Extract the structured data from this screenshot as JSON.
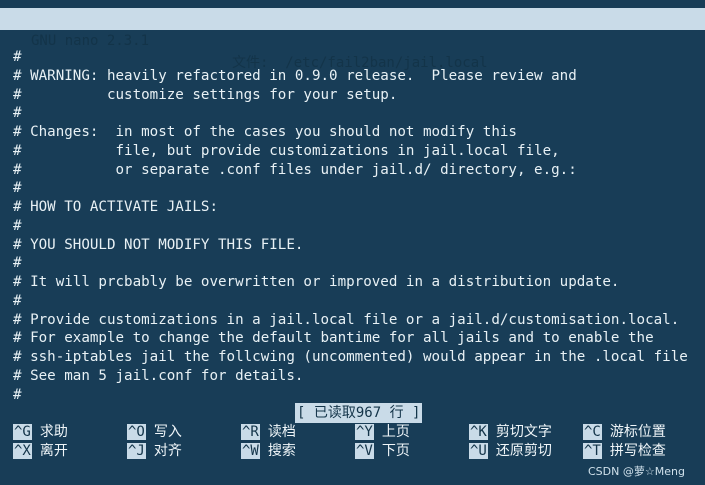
{
  "titlebar": {
    "app": "GNU nano 2.3.1",
    "file": "文件:  /etc/fail2ban/jail.local"
  },
  "editor": {
    "lines": [
      "#",
      "# WARNING: heavily refactored in 0.9.0 release.  Please review and",
      "#          customize settings for your setup.",
      "#",
      "# Changes:  in most of the cases you should not modify this",
      "#           file, but provide customizations in jail.local file,",
      "#           or separate .conf files under jail.d/ directory, e.g.:",
      "#",
      "# HOW TO ACTIVATE JAILS:",
      "#",
      "# YOU SHOULD NOT MODIFY THIS FILE.",
      "#",
      "# It will prcbably be overwritten or improved in a distribution update.",
      "#",
      "# Provide customizations in a jail.local file or a jail.d/customisation.local.",
      "# For example to change the default bantime for all jails and to enable the",
      "# ssh-iptables jail the follcwing (uncommented) would appear in the .local file",
      "# See man 5 jail.conf for details.",
      "#"
    ]
  },
  "status": {
    "message": "[ 已读取967 行 ]"
  },
  "shortcuts": [
    {
      "key": "^G",
      "label": "求助"
    },
    {
      "key": "^O",
      "label": "写入"
    },
    {
      "key": "^R",
      "label": "读档"
    },
    {
      "key": "^Y",
      "label": "上页"
    },
    {
      "key": "^K",
      "label": "剪切文字"
    },
    {
      "key": "^C",
      "label": "游标位置"
    },
    {
      "key": "^X",
      "label": "离开"
    },
    {
      "key": "^J",
      "label": "对齐"
    },
    {
      "key": "^W",
      "label": "搜索"
    },
    {
      "key": "^V",
      "label": "下页"
    },
    {
      "key": "^U",
      "label": "还原剪切"
    },
    {
      "key": "^T",
      "label": "拼写检查"
    }
  ],
  "watermark": "CSDN @萝☆Meng",
  "colors": {
    "background": "#183d57",
    "highlight": "#c9dbe8",
    "text": "#e8f1f5"
  }
}
